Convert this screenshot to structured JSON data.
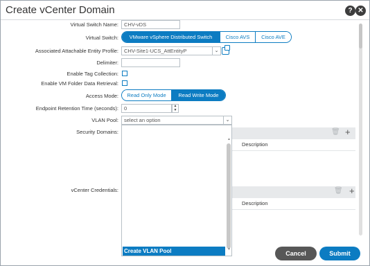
{
  "dialog": {
    "title": "Create vCenter Domain",
    "help_icon_glyph": "?",
    "close_icon_glyph": "✕"
  },
  "form": {
    "vswitch_name": {
      "label": "Virtual Switch Name:",
      "value": "CHV-vDS"
    },
    "vswitch": {
      "label": "Virtual Switch:",
      "options": [
        "VMware vSphere Distributed Switch",
        "Cisco AVS",
        "Cisco AVE"
      ],
      "selected": "VMware vSphere Distributed Switch"
    },
    "aaep": {
      "label": "Associated Attachable Entity Profile:",
      "value": "CHV-Site1-UCS_AttEntityP"
    },
    "delimiter": {
      "label": "Delimiter:",
      "value": ""
    },
    "tag_collection": {
      "label": "Enable Tag Collection:",
      "checked": false
    },
    "vm_folder": {
      "label": "Enable VM Folder Data Retrieval:",
      "checked": false
    },
    "access_mode": {
      "label": "Access Mode:",
      "options": [
        "Read Only Mode",
        "Read Write Mode"
      ],
      "selected": "Read Write Mode"
    },
    "endpoint_retention": {
      "label": "Endpoint Retention Time (seconds):",
      "value": "0"
    },
    "vlan_pool": {
      "label": "VLAN Pool:",
      "placeholder": "select an option",
      "dropdown_items": [
        "Create VLAN Pool"
      ]
    },
    "security_domains": {
      "label": "Security Domains:",
      "column": "Description"
    },
    "vcenter_credentials": {
      "label": "vCenter Credentials:",
      "column": "Description"
    }
  },
  "footer": {
    "cancel_label": "Cancel",
    "submit_label": "Submit"
  },
  "colors": {
    "accent": "#0c7cc2",
    "cancel": "#575757"
  }
}
